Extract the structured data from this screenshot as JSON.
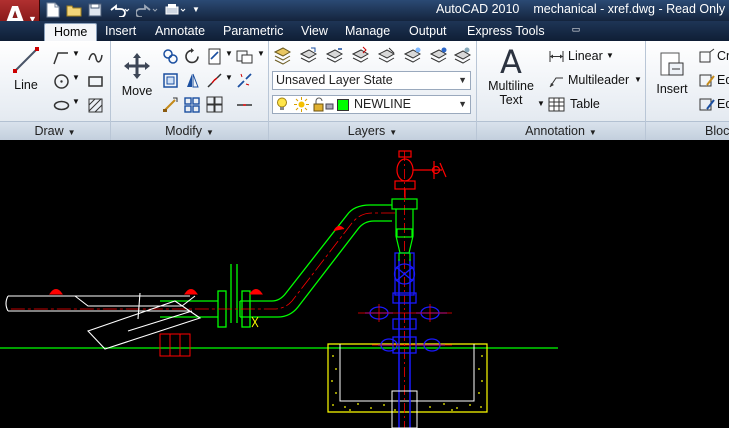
{
  "title_bar": {
    "app": "AutoCAD 2010",
    "document": "mechanical - xref.dwg - Read Only"
  },
  "quick_access": {
    "items": [
      "new-icon",
      "open-icon",
      "save-icon",
      "undo-icon",
      "redo-icon",
      "plot-icon"
    ]
  },
  "tabs": [
    {
      "label": "Home",
      "active": true
    },
    {
      "label": "Insert"
    },
    {
      "label": "Annotate"
    },
    {
      "label": "Parametric"
    },
    {
      "label": "View"
    },
    {
      "label": "Manage"
    },
    {
      "label": "Output"
    },
    {
      "label": "Express Tools"
    }
  ],
  "panels": {
    "draw": {
      "title": "Draw",
      "line_label": "Line"
    },
    "modify": {
      "title": "Modify",
      "move_label": "Move"
    },
    "layers": {
      "title": "Layers",
      "layer_state": "Unsaved Layer State",
      "current_layer": "NEWLINE",
      "current_layer_color": "#00ff00"
    },
    "annotation": {
      "title": "Annotation",
      "multiline_text_label_1": "Multiline",
      "multiline_text_label_2": "Text",
      "linear_label": "Linear",
      "multileader_label": "Multileader",
      "table_label": "Table"
    },
    "block": {
      "title": "Block",
      "insert_label": "Insert",
      "create_label": "Cr",
      "edit_label": "Ed",
      "edit_attr_label": "Ed"
    }
  },
  "colors": {
    "accent": "#c0392b",
    "ribbon_bg": "#e8edf3",
    "drawing_bg": "#000000",
    "layer_green": "#00ff00",
    "layer_red": "#ff0000",
    "layer_blue": "#1a1aff",
    "layer_yellow": "#ffff00",
    "layer_white": "#ffffff"
  }
}
